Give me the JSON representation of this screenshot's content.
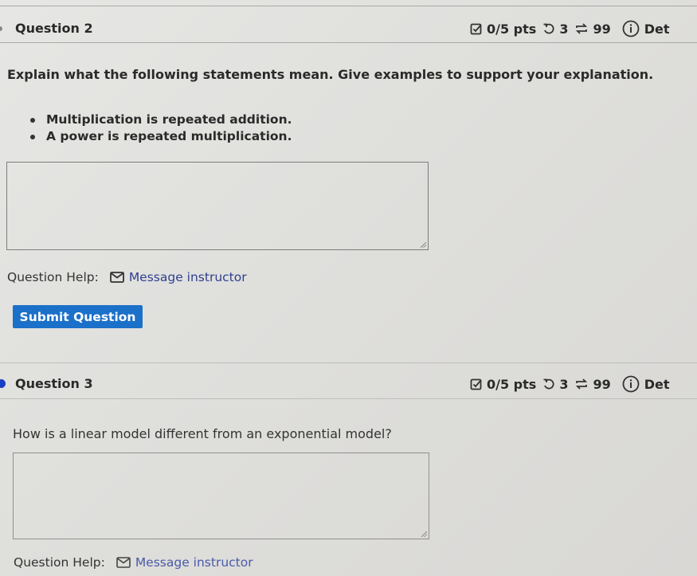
{
  "questions": [
    {
      "title": "Question 2",
      "status_dot": false,
      "meta": {
        "points": "0/5 pts",
        "retries": "3",
        "attempts": "99",
        "details_label": "Det"
      },
      "prompt": "Explain what the following statements mean. Give examples to support your explanation.",
      "bullets": [
        "Multiplication is repeated addition.",
        "A power is repeated multiplication."
      ],
      "answer_value": "",
      "help_label": "Question Help:",
      "message_link": "Message instructor",
      "submit_label": "Submit Question"
    },
    {
      "title": "Question 3",
      "status_dot": true,
      "status_color": "#1a3fc4",
      "meta": {
        "points": "0/5 pts",
        "retries": "3",
        "attempts": "99",
        "details_label": "Det"
      },
      "prompt": "How is a linear model different from an exponential model?",
      "answer_value": "",
      "help_label": "Question Help:",
      "message_link": "Message instructor"
    }
  ],
  "colors": {
    "accent_button": "#1b70c9",
    "link": "#2f3f8f"
  }
}
